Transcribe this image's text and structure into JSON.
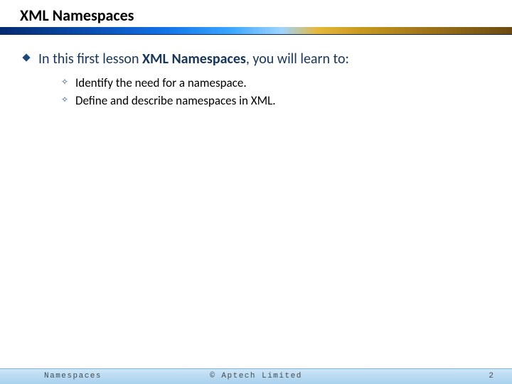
{
  "title": "XML Namespaces",
  "intro": {
    "prefix": "In this first lesson ",
    "bold": "XML Namespaces",
    "suffix": ", you will learn to:"
  },
  "objectives": [
    "Identify the need for a namespace.",
    "Define and describe namespaces in XML."
  ],
  "footer": {
    "left": "Namespaces",
    "center": "© Aptech Limited",
    "page": "2"
  },
  "colors": {
    "title_text": "#000000",
    "body_text": "#16365c",
    "diamond_fill": "#1f497d",
    "footer_band": "#bcdcf2"
  }
}
